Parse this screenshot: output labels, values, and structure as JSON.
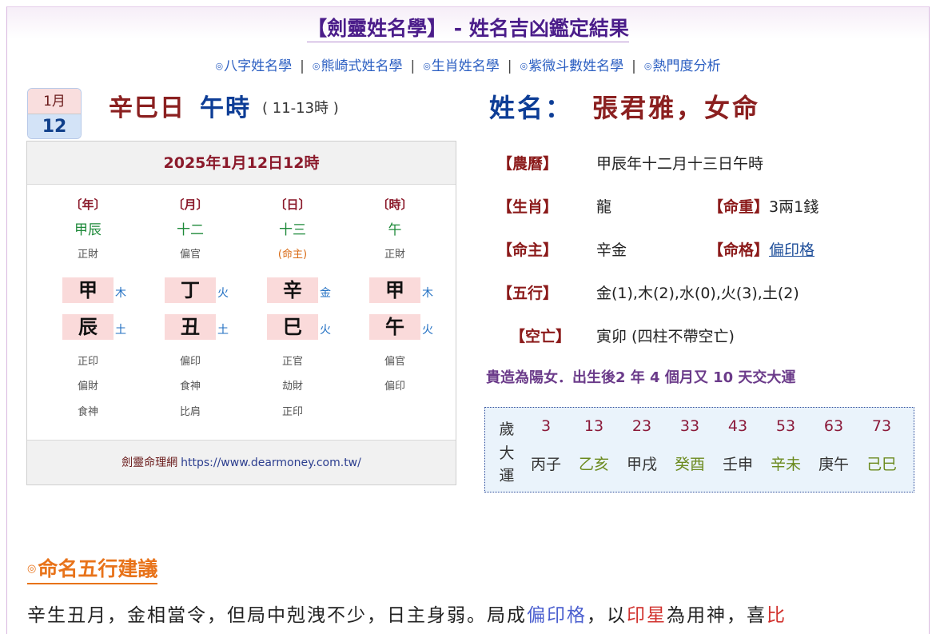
{
  "header": {
    "title": "【劍靈姓名學】 - 姓名吉凶鑑定結果"
  },
  "nav": [
    {
      "label": "八字姓名學"
    },
    {
      "label": "熊崎式姓名學"
    },
    {
      "label": "生肖姓名學"
    },
    {
      "label": "紫微斗數姓名學"
    },
    {
      "label": "熱門度分析"
    }
  ],
  "nav_icon": "◎",
  "nav_sep": "|",
  "calendar": {
    "month": "1月",
    "day": "12"
  },
  "birth": {
    "day_pillar": "辛巳日",
    "hour": "午時",
    "hour_range": "( 11-13時 )"
  },
  "name": {
    "label": "姓名：",
    "value": "張君雅，女命"
  },
  "bazi": {
    "date": "2025年1月12日12時",
    "pillars": [
      {
        "label": "〔年〕",
        "lunar": "甲辰",
        "god": "正財",
        "stem": "甲",
        "stem_el": "木",
        "branch": "辰",
        "branch_el": "土",
        "hidden": [
          "正印",
          "偏財",
          "食神"
        ]
      },
      {
        "label": "〔月〕",
        "lunar": "十二",
        "god": "偏官",
        "stem": "丁",
        "stem_el": "火",
        "branch": "丑",
        "branch_el": "土",
        "hidden": [
          "偏印",
          "食神",
          "比肩"
        ]
      },
      {
        "label": "〔日〕",
        "lunar": "十三",
        "god": "(命主)",
        "stem": "辛",
        "stem_el": "金",
        "branch": "巳",
        "branch_el": "火",
        "hidden": [
          "正官",
          "劫財",
          "正印"
        ]
      },
      {
        "label": "〔時〕",
        "lunar": "午",
        "god": "正財",
        "stem": "甲",
        "stem_el": "木",
        "branch": "午",
        "branch_el": "火",
        "hidden": [
          "偏官",
          "偏印",
          ""
        ]
      }
    ],
    "footer_name": "劍靈命理網",
    "footer_url": "https://www.dearmoney.com.tw/"
  },
  "info": {
    "lunar_label": "【農曆】",
    "lunar_value": "甲辰年十二月十三日午時",
    "zodiac_label": "【生肖】",
    "zodiac_value": "龍",
    "weight_label": "【命重】",
    "weight_value": "3兩1錢",
    "master_label": "【命主】",
    "master_value": "辛金",
    "pattern_label": "【命格】",
    "pattern_value": "偏印格",
    "wuxing_label": "【五行】",
    "wuxing_value": "金(1),木(2),水(0),火(3),土(2)",
    "void_label": "【空亡】",
    "void_value": "寅卯 (四柱不帶空亡)"
  },
  "luck": {
    "note": "貴造為陽女．出生後2 年 4 個月又 10 天交大運",
    "age_label": "歲",
    "luck_label": [
      "大",
      "運"
    ],
    "ages": [
      "3",
      "13",
      "23",
      "33",
      "43",
      "53",
      "63",
      "73"
    ],
    "pillars": [
      {
        "text": "丙子",
        "color": "#333333"
      },
      {
        "text": "乙亥",
        "color": "#6b8a1e"
      },
      {
        "text": "甲戌",
        "color": "#333333"
      },
      {
        "text": "癸酉",
        "color": "#6b8a1e"
      },
      {
        "text": "壬申",
        "color": "#333333"
      },
      {
        "text": "辛未",
        "color": "#6b8a1e"
      },
      {
        "text": "庚午",
        "color": "#333333"
      },
      {
        "text": "己巳",
        "color": "#6b8a1e"
      }
    ]
  },
  "advice": {
    "icon": "◎",
    "title": "命名五行建議",
    "para_1": "辛生丑月，金相當令，但局中剋洩不少，日主身弱。局成",
    "para_blue": "偏印格",
    "para_2": "，以",
    "para_red1": "印星",
    "para_3": "為用神，喜",
    "para_red2": "比"
  },
  "colors": {
    "accent_purple": "#4b1d8a",
    "accent_red": "#8b1a1a",
    "accent_blue": "#0d3d96",
    "accent_orange": "#e8731a"
  }
}
